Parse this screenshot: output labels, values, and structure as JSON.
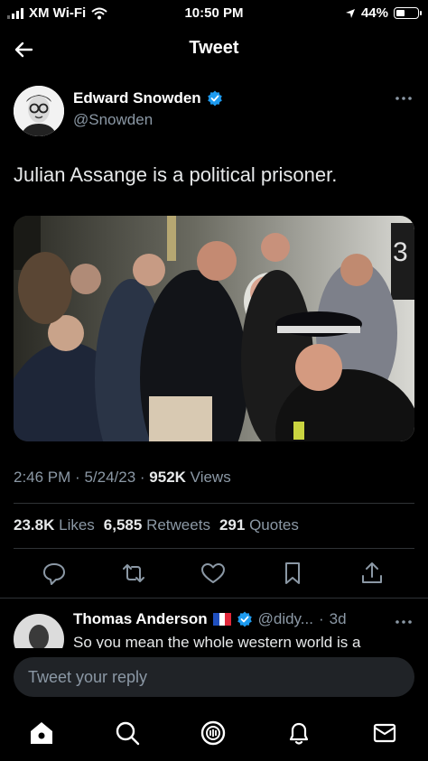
{
  "status_bar": {
    "carrier": "XM Wi-Fi",
    "time": "10:50 PM",
    "battery_percent": "44%",
    "battery_level": 0.44
  },
  "header": {
    "title": "Tweet"
  },
  "tweet": {
    "author_name": "Edward Snowden",
    "author_handle": "@Snowden",
    "text": "Julian Assange is a political prisoner.",
    "time": "2:46 PM",
    "date": "5/24/23",
    "views_count": "952K",
    "views_label": "Views",
    "likes_count": "23.8K",
    "likes_label": "Likes",
    "retweets_count": "6,585",
    "retweets_label": "Retweets",
    "quotes_count": "291",
    "quotes_label": "Quotes"
  },
  "reply": {
    "author_name": "Thomas Anderson",
    "author_handle": "@didy...",
    "age": "3d",
    "text": "So you mean the whole western world is a"
  },
  "composer": {
    "placeholder": "Tweet your reply"
  },
  "colors": {
    "verified": "#1d9bf0",
    "muted": "#8b98a5",
    "background": "#000000"
  },
  "icons": [
    "back-arrow-icon",
    "verified-badge-icon",
    "more-icon",
    "reply-icon",
    "retweet-icon",
    "like-icon",
    "bookmark-icon",
    "share-icon",
    "home-icon",
    "search-icon",
    "spaces-icon",
    "notifications-icon",
    "messages-icon"
  ]
}
